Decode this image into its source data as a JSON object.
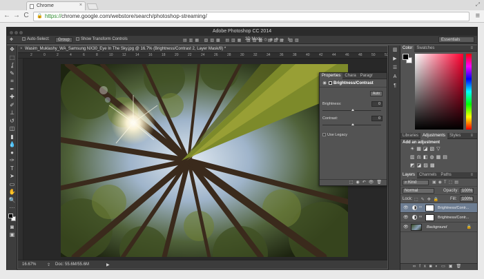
{
  "browser": {
    "tab_title": "Chrome",
    "tab_close": "×",
    "url_scheme": "https://",
    "url_rest": "chrome.google.com/webstore/search/photoshop-streaming/",
    "back": "←",
    "forward": "→",
    "reload": "C",
    "menu": "≡"
  },
  "ps": {
    "title": "Adobe Photoshop CC 2014",
    "options": {
      "auto_select_label": "Auto-Select:",
      "auto_select_value": "Group",
      "show_transform": "Show Transform Controls",
      "mode_3d": "3D Mode:",
      "workspace": "Essentials"
    },
    "doc_tab": "Wasim_Muklashy_WA_Samsung NX30_Eye In The Sky.jpg @ 16.7% (Brightness/Contrast 2, Layer Mask/8) *",
    "doc_close": "×",
    "ruler_ticks": [
      "2",
      "0",
      "2",
      "4",
      "6",
      "8",
      "10",
      "12",
      "14",
      "16",
      "18",
      "20",
      "22",
      "24",
      "26",
      "28",
      "30",
      "32",
      "34",
      "36",
      "38",
      "40",
      "42",
      "44",
      "46",
      "48",
      "50",
      "52"
    ],
    "status": {
      "zoom": "16.67%",
      "doc": "Doc: 55.6M/55.6M"
    },
    "properties": {
      "tabs": [
        "Properties",
        "Chara",
        "Paragr"
      ],
      "header": "Brightness/Contrast",
      "auto": "Auto",
      "brightness_label": "Brightness:",
      "brightness_value": "0",
      "contrast_label": "Contrast:",
      "contrast_value": "0",
      "use_legacy": "Use Legacy"
    },
    "color_panel": {
      "tabs": [
        "Color",
        "Swatches"
      ],
      "foreground": "#000000",
      "background": "#ffffff"
    },
    "adjustments_panel": {
      "tabs": [
        "Libraries",
        "Adjustments",
        "Styles"
      ],
      "heading": "Add an adjustment"
    },
    "layers_panel": {
      "tabs": [
        "Layers",
        "Channels",
        "Paths"
      ],
      "filter": "Kind",
      "blend_mode": "Normal",
      "opacity_label": "Opacity:",
      "opacity_value": "100%",
      "lock_label": "Lock:",
      "fill_label": "Fill:",
      "fill_value": "100%",
      "layers": [
        {
          "name": "Brightness/Contr...",
          "selected": true
        },
        {
          "name": "Brightness/Contr...",
          "selected": false
        },
        {
          "name": "Background",
          "selected": false
        }
      ]
    }
  }
}
